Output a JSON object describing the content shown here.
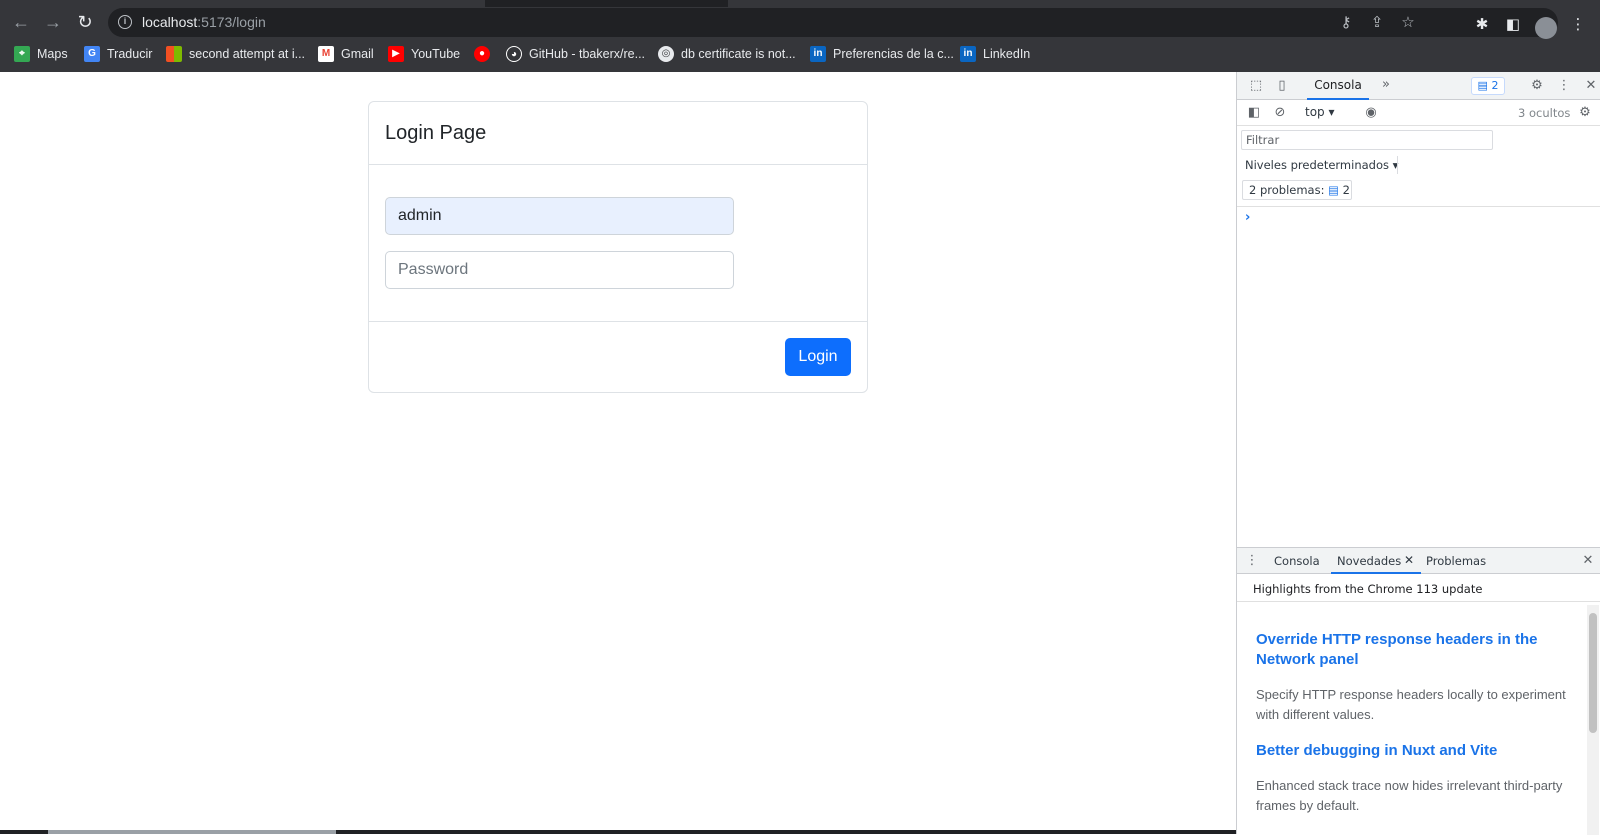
{
  "browser": {
    "url_host": "localhost",
    "url_rest": ":5173/login",
    "bookmarks": [
      {
        "label": "Maps",
        "icon": "maps-icon",
        "color": "#34a853"
      },
      {
        "label": "Traducir",
        "icon": "translate-icon",
        "color": "#4285f4"
      },
      {
        "label": "second attempt at i...",
        "icon": "microsoft-icon",
        "color": "#f25022"
      },
      {
        "label": "Gmail",
        "icon": "gmail-icon",
        "color": "#ea4335"
      },
      {
        "label": "YouTube",
        "icon": "youtube-icon",
        "color": "#ff0000"
      },
      {
        "label": "",
        "icon": "music-icon",
        "color": "#ff0000"
      },
      {
        "label": "GitHub - tbakerx/re...",
        "icon": "github-icon",
        "color": "#ffffff"
      },
      {
        "label": "db certificate is not...",
        "icon": "globe-icon",
        "color": "#e8eaed"
      },
      {
        "label": "Preferencias de la c...",
        "icon": "linkedin-icon",
        "color": "#0a66c2"
      },
      {
        "label": "LinkedIn",
        "icon": "linkedin-icon",
        "color": "#0a66c2"
      }
    ]
  },
  "login": {
    "title": "Login Page",
    "username_value": "admin",
    "password_placeholder": "Password",
    "button_label": "Login",
    "accent": "#0d6efd"
  },
  "devtools": {
    "tab_console": "Consola",
    "issues_count": "2",
    "context": "top",
    "hidden": "3 ocultos",
    "filter_placeholder": "Filtrar",
    "levels": "Niveles predeterminados",
    "problems_label": "2 problemas:",
    "problems_count": "2",
    "drawer": {
      "tabs": [
        "Consola",
        "Novedades",
        "Problemas"
      ],
      "header": "Highlights from the Chrome 113 update",
      "items": [
        {
          "title": "Override HTTP response headers in the Network panel",
          "desc": "Specify HTTP response headers locally to experiment with different values."
        },
        {
          "title": "Better debugging in Nuxt and Vite",
          "desc": "Enhanced stack trace now hides irrelevant third-party frames by default."
        }
      ]
    }
  }
}
